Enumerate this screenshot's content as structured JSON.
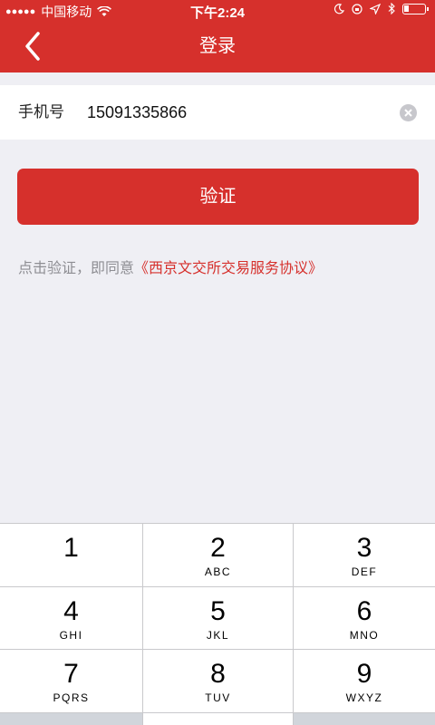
{
  "status_bar": {
    "carrier": "中国移动",
    "time": "下午2:24"
  },
  "nav": {
    "title": "登录",
    "back_icon": "chevron-left-icon"
  },
  "phone": {
    "label": "手机号",
    "value": "15091335866",
    "clear_icon": "clear-circle-icon"
  },
  "verify_button": "验证",
  "agreement": {
    "prefix": "点击验证，即同意",
    "link": "《西京文交所交易服务协议》"
  },
  "keypad": {
    "keys": [
      {
        "num": "1",
        "letters": ""
      },
      {
        "num": "2",
        "letters": "ABC"
      },
      {
        "num": "3",
        "letters": "DEF"
      },
      {
        "num": "4",
        "letters": "GHI"
      },
      {
        "num": "5",
        "letters": "JKL"
      },
      {
        "num": "6",
        "letters": "MNO"
      },
      {
        "num": "7",
        "letters": "PQRS"
      },
      {
        "num": "8",
        "letters": "TUV"
      },
      {
        "num": "9",
        "letters": "WXYZ"
      }
    ]
  },
  "colors": {
    "brand_red": "#d6302c",
    "background": "#efeff4",
    "muted_text": "#8e8e93"
  }
}
